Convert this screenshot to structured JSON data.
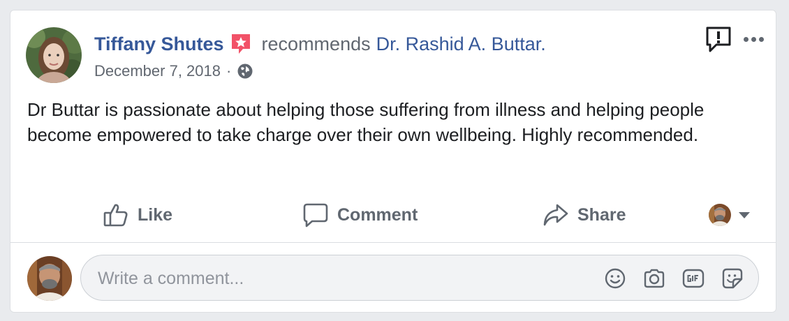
{
  "post": {
    "author": "Tiffany Shutes",
    "recommends_text": "recommends",
    "recommended_page": "Dr. Rashid A. Buttar.",
    "date": "December 7, 2018",
    "separator": "·",
    "privacy_icon": "globe-icon",
    "body": "Dr Buttar is passionate about helping those suffering from illness and helping people become empowered to take charge over their own wellbeing. Highly recommended."
  },
  "actions": {
    "like_label": "Like",
    "comment_label": "Comment",
    "share_label": "Share"
  },
  "comment_box": {
    "placeholder": "Write a comment...",
    "value": "",
    "icons": [
      "emoji-icon",
      "camera-icon",
      "gif-icon",
      "sticker-icon"
    ]
  },
  "colors": {
    "link_blue": "#365899",
    "text_gray": "#616770",
    "recommend_badge": "#f25268",
    "page_bg": "#e9ebee"
  }
}
